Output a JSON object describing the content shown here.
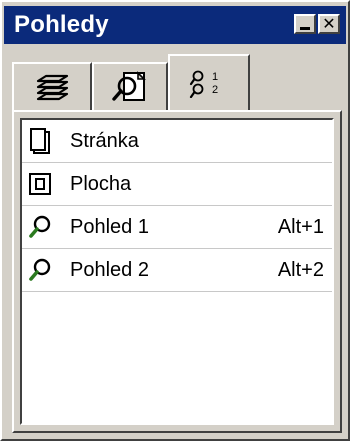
{
  "window": {
    "title": "Pohledy"
  },
  "tabs": [
    {
      "icon": "layers-icon"
    },
    {
      "icon": "page-zoom-icon"
    },
    {
      "icon": "views-list-icon",
      "selected": true
    }
  ],
  "list": {
    "items": [
      {
        "label": "Stránka",
        "shortcut": "",
        "icon": "page-icon"
      },
      {
        "label": "Plocha",
        "shortcut": "",
        "icon": "canvas-icon"
      },
      {
        "label": "Pohled 1",
        "shortcut": "Alt+1",
        "icon": "magnifier-icon"
      },
      {
        "label": "Pohled 2",
        "shortcut": "Alt+2",
        "icon": "magnifier-icon"
      }
    ]
  },
  "colors": {
    "titlebar": "#0b2a7b",
    "face": "#d4d0c8",
    "magnifier_handle": "#2b7a1f"
  }
}
